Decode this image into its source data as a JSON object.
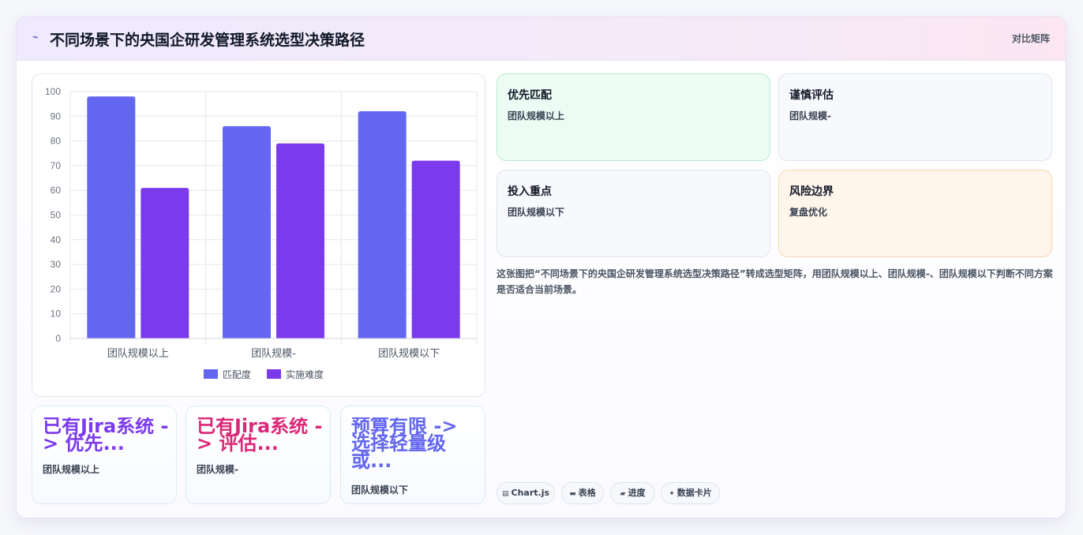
{
  "header": {
    "icon": "trend-icon",
    "title": "不同场景下的央国企研发管理系统选型决策路径",
    "right_link": "对比矩阵"
  },
  "chart_data": {
    "type": "bar",
    "categories": [
      "团队规模以上",
      "团队规模-",
      "团队规模以下"
    ],
    "series": [
      {
        "name": "匹配度",
        "values": [
          98,
          86.0,
          92
        ],
        "color": "#6366f1"
      },
      {
        "name": "实施难度",
        "values": [
          61,
          79,
          72
        ],
        "color": "#7c3aed"
      }
    ],
    "ylim": [
      0,
      100
    ],
    "yticks": [
      "0",
      "10",
      "20",
      "30",
      "40",
      "50",
      "60",
      "70",
      "80",
      "90",
      "100"
    ],
    "grid": true,
    "legend": "bottom"
  },
  "bottom_cards": [
    {
      "headline": "已有Jira系统 -> 优先...",
      "sub": "团队规模以上",
      "color": "#7c3aed"
    },
    {
      "headline": "已有Jira系统 -> 评估...",
      "sub": "团队规模-",
      "color": "#db2777"
    },
    {
      "headline": "预算有限 -> 选择轻量级或...",
      "sub": "团队规模以下",
      "color": "#6366f1"
    }
  ],
  "tiles": [
    {
      "title": "优先匹配",
      "sub": "团队规模以上"
    },
    {
      "title": "谨慎评估",
      "sub": "团队规模-"
    },
    {
      "title": "投入重点",
      "sub": "团队规模以下"
    },
    {
      "title": "风险边界",
      "sub": "复盘优化"
    }
  ],
  "description": "这张图把“不同场景下的央国企研发管理系统选型决策路径”转成选型矩阵，用团队规模以上、团队规模-、团队规模以下判断不同方案是否适合当前场景。",
  "pills": [
    {
      "icon": "chart-icon",
      "label": "Chart.js"
    },
    {
      "icon": "table-icon",
      "label": "表格"
    },
    {
      "icon": "progress-icon",
      "label": "进度"
    },
    {
      "icon": "sparkle-icon",
      "label": "数据卡片"
    }
  ]
}
